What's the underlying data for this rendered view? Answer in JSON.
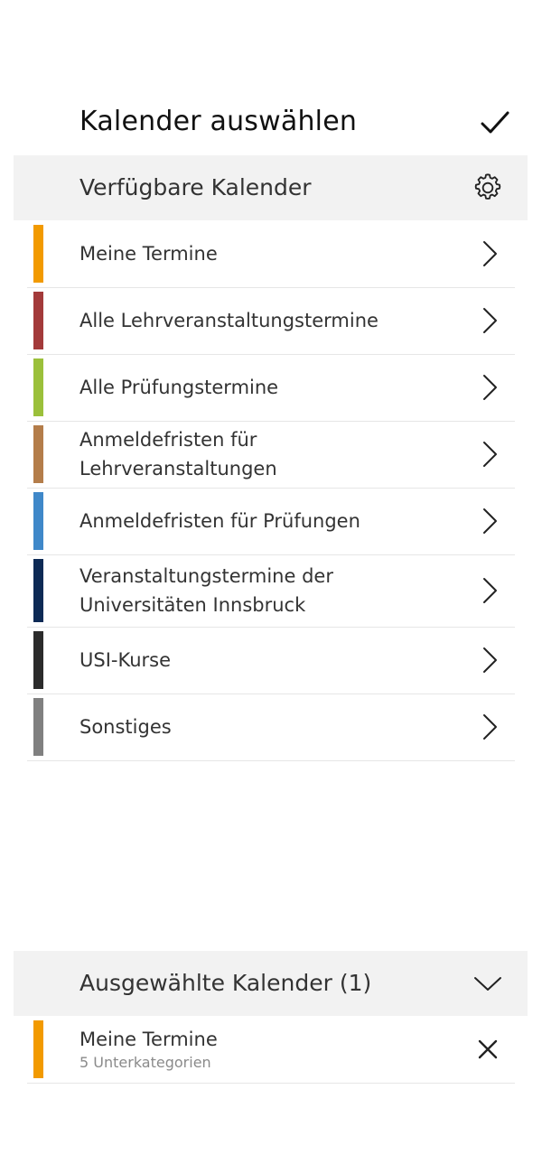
{
  "header": {
    "title": "Kalender auswählen",
    "confirm_icon": "checkmark-icon"
  },
  "available": {
    "title": "Verfügbare Kalender",
    "settings_icon": "gear-icon",
    "items": [
      {
        "label": "Meine Termine",
        "color": "#F29A00"
      },
      {
        "label": "Alle Lehrveranstaltungstermine",
        "color": "#A33A3A"
      },
      {
        "label": "Alle Prüfungstermine",
        "color": "#9BC03A"
      },
      {
        "label": "Anmeldefristen für Lehrveranstaltungen",
        "color": "#B47D4A"
      },
      {
        "label": "Anmeldefristen für Prüfungen",
        "color": "#3F88C9"
      },
      {
        "label": "Veranstaltungstermine der Universitäten Innsbruck",
        "color": "#0D2A55"
      },
      {
        "label": "USI-Kurse",
        "color": "#2B2B2B"
      },
      {
        "label": "Sonstiges",
        "color": "#808080"
      }
    ]
  },
  "selected": {
    "title": "Ausgewählte Kalender (1)",
    "toggle_icon": "chevron-down-icon",
    "items": [
      {
        "label": "Meine Termine",
        "sub": "5 Unterkategorien",
        "color": "#F29A00"
      }
    ]
  }
}
